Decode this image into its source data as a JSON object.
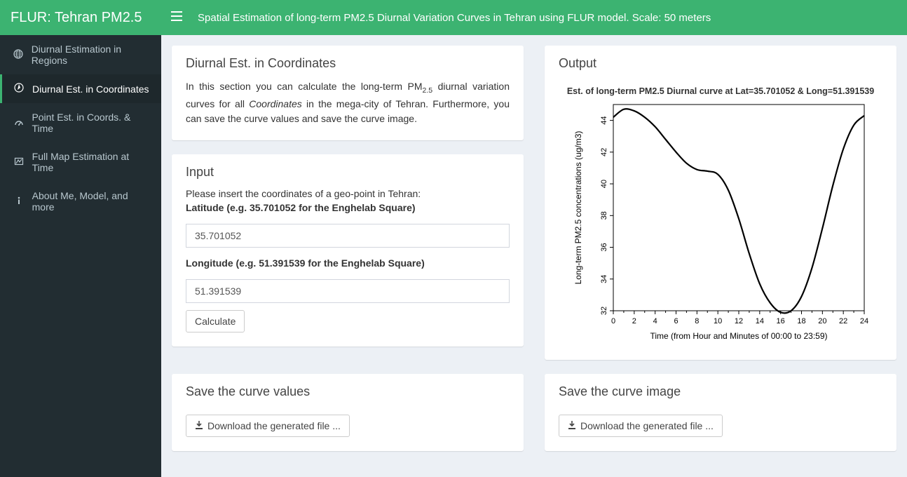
{
  "brand": "FLUR: Tehran PM2.5",
  "top_description": "Spatial Estimation of long-term PM2.5 Diurnal Variation Curves in Tehran using FLUR model. Scale: 50 meters",
  "sidebar": {
    "items": [
      {
        "label": "Diurnal Estimation in Regions",
        "icon": "globe"
      },
      {
        "label": "Diurnal Est. in Coordinates",
        "icon": "compass"
      },
      {
        "label": "Point Est. in Coords. & Time",
        "icon": "dashboard"
      },
      {
        "label": "Full Map Estimation at Time",
        "icon": "map"
      },
      {
        "label": "About Me, Model, and more",
        "icon": "info"
      }
    ]
  },
  "main": {
    "card_coords": {
      "title": "Diurnal Est. in Coordinates",
      "desc_pre": "In this section you can calculate the long-term PM",
      "desc_sub": "2.5",
      "desc_post": " diurnal variation curves for all ",
      "desc_em": "Coordinates",
      "desc_tail": " in the mega-city of Tehran. Furthermore, you can save the curve values and save the curve image."
    },
    "card_input": {
      "title": "Input",
      "prompt": "Please insert the coordinates of a geo-point in Tehran:",
      "lat_label": "Latitude (e.g. 35.701052 for the Enghelab Square)",
      "lat_value": "35.701052",
      "lon_label": "Longitude (e.g. 51.391539 for the Enghelab Square)",
      "lon_value": "51.391539",
      "calc_label": "Calculate"
    },
    "card_save_values": {
      "title": "Save the curve values",
      "btn": "Download the generated file ..."
    },
    "card_output": {
      "title": "Output"
    },
    "card_save_image": {
      "title": "Save the curve image",
      "btn": "Download the generated file ..."
    }
  },
  "chart_data": {
    "type": "line",
    "title": "Est. of long-term PM2.5 Diurnal curve at Lat=35.701052 & Long=51.391539",
    "xlabel": "Time (from Hour and Minutes of 00:00 to 23:59)",
    "ylabel": "Long-term PM2.5 concentrations (ug/m3)",
    "xlim": [
      0,
      24
    ],
    "ylim": [
      32,
      45
    ],
    "x_ticks": [
      0,
      2,
      4,
      6,
      8,
      10,
      12,
      14,
      16,
      18,
      20,
      22,
      24
    ],
    "y_ticks": [
      32,
      34,
      36,
      38,
      40,
      42,
      44
    ],
    "x": [
      0,
      1,
      2,
      3,
      4,
      5,
      6,
      7,
      8,
      9,
      10,
      11,
      12,
      13,
      14,
      15,
      16,
      17,
      18,
      19,
      20,
      21,
      22,
      23,
      24
    ],
    "values": [
      44.2,
      44.7,
      44.6,
      44.2,
      43.6,
      42.8,
      42.0,
      41.3,
      40.9,
      40.8,
      40.6,
      39.6,
      37.8,
      35.6,
      33.7,
      32.5,
      31.9,
      32.0,
      32.9,
      34.7,
      37.2,
      39.9,
      42.2,
      43.7,
      44.3
    ]
  }
}
